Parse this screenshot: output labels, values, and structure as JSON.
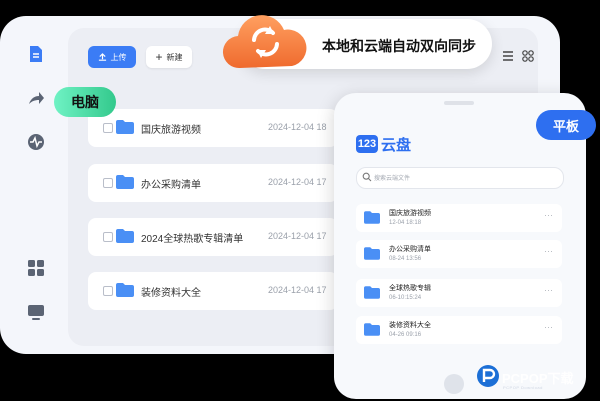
{
  "colors": {
    "accent": "#2e6ff0",
    "folder": "#4a8ff5",
    "tag_pc": "#3ed69a",
    "cloud": "#f47a3c"
  },
  "desktop": {
    "toolbar": {
      "upload_label": "上传",
      "new_label": "新建"
    },
    "files": [
      {
        "name": "国庆旅游视频",
        "date": "2024-12-04 18"
      },
      {
        "name": "办公采购清单",
        "date": "2024-12-04 17"
      },
      {
        "name": "2024全球热歌专辑清单",
        "date": "2024-12-04 17"
      },
      {
        "name": "装修资料大全",
        "date": "2024-12-04 17"
      }
    ]
  },
  "tags": {
    "pc": "电脑",
    "tablet": "平板"
  },
  "sync": {
    "text": "本地和云端自动双向同步"
  },
  "tablet": {
    "logo_number": "123",
    "logo_text": "云盘",
    "search_placeholder": "搜索云端文件",
    "files": [
      {
        "name": "国庆旅游视频",
        "date": "12-04 18:18"
      },
      {
        "name": "办公采购清单",
        "date": "08-24 13:56"
      },
      {
        "name": "全球热歌专辑",
        "date": "06-10:15:24"
      },
      {
        "name": "装修资料大全",
        "date": "04-26 09:16"
      }
    ],
    "more_glyph": "···"
  },
  "watermark": {
    "text": "PCPOP下载",
    "sub": "PCPOP Download"
  }
}
